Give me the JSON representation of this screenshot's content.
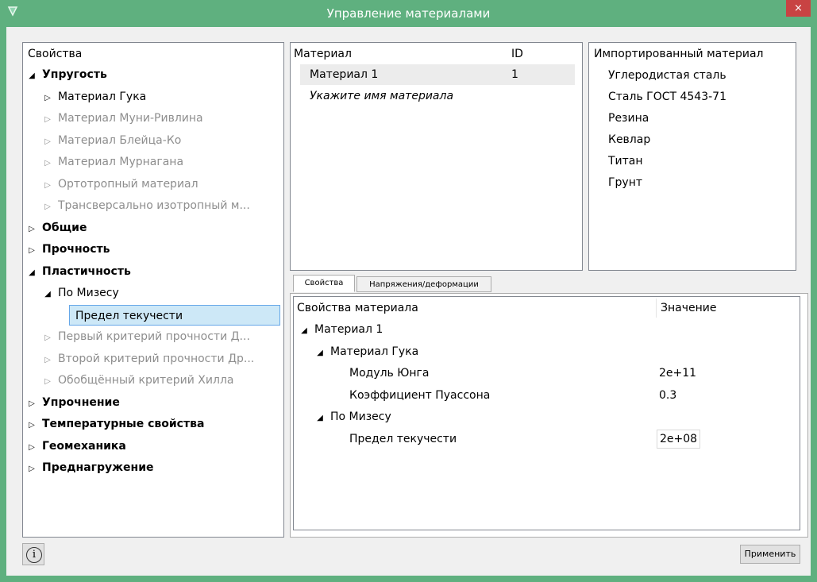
{
  "window": {
    "title": "Управление материалами",
    "close_glyph": "×"
  },
  "left_panel": {
    "header": "Свойства",
    "items": [
      {
        "label": "Упругость",
        "level": 0,
        "arrow": "◢",
        "style": "bold"
      },
      {
        "label": "Материал Гука",
        "level": 1,
        "arrow": "▷",
        "style": "normal"
      },
      {
        "label": "Материал Муни-Ривлина",
        "level": 1,
        "arrow": "▷",
        "style": "gray"
      },
      {
        "label": "Материал Блейца-Ко",
        "level": 1,
        "arrow": "▷",
        "style": "gray"
      },
      {
        "label": "Материал Мурнагана",
        "level": 1,
        "arrow": "▷",
        "style": "gray"
      },
      {
        "label": "Ортотропный материал",
        "level": 1,
        "arrow": "▷",
        "style": "gray"
      },
      {
        "label": "Трансверсально изотропный м...",
        "level": 1,
        "arrow": "▷",
        "style": "gray"
      },
      {
        "label": "Общие",
        "level": 0,
        "arrow": "▷",
        "style": "bold"
      },
      {
        "label": "Прочность",
        "level": 0,
        "arrow": "▷",
        "style": "bold"
      },
      {
        "label": "Пластичность",
        "level": 0,
        "arrow": "◢",
        "style": "bold"
      },
      {
        "label": "По Мизесу",
        "level": 1,
        "arrow": "◢",
        "style": "normal"
      },
      {
        "label": "Предел текучести",
        "level": 2,
        "arrow": "",
        "style": "selected"
      },
      {
        "label": "Первый критерий прочности Д...",
        "level": 1,
        "arrow": "▷",
        "style": "gray"
      },
      {
        "label": "Второй критерий прочности Др...",
        "level": 1,
        "arrow": "▷",
        "style": "gray"
      },
      {
        "label": "Обобщённый критерий Хилла",
        "level": 1,
        "arrow": "▷",
        "style": "gray"
      },
      {
        "label": "Упрочнение",
        "level": 0,
        "arrow": "▷",
        "style": "bold"
      },
      {
        "label": "Температурные свойства",
        "level": 0,
        "arrow": "▷",
        "style": "bold"
      },
      {
        "label": "Геомеханика",
        "level": 0,
        "arrow": "▷",
        "style": "bold"
      },
      {
        "label": "Преднагружение",
        "level": 0,
        "arrow": "▷",
        "style": "bold"
      }
    ]
  },
  "materials_panel": {
    "col_material": "Материал",
    "col_id": "ID",
    "rows": [
      {
        "name": "Материал 1",
        "id": "1"
      }
    ],
    "placeholder": "Укажите имя материала"
  },
  "imported_panel": {
    "header": "Импортированный материал",
    "items": [
      "Углеродистая сталь",
      "Сталь ГОСТ 4543-71",
      "Резина",
      "Кевлар",
      "Титан",
      "Грунт"
    ]
  },
  "tabs": [
    {
      "label": "Свойства",
      "active": true
    },
    {
      "label": "Напряжения/деформации",
      "active": false
    }
  ],
  "props_panel": {
    "col_property": "Свойства материала",
    "col_value": "Значение",
    "rows": [
      {
        "label": "Материал 1",
        "value": "",
        "level": 0,
        "arrow": "◢"
      },
      {
        "label": "Материал Гука",
        "value": "",
        "level": 1,
        "arrow": "◢"
      },
      {
        "label": "Модуль Юнга",
        "value": "2e+11",
        "level": 2,
        "arrow": ""
      },
      {
        "label": "Коэффициент Пуассона",
        "value": "0.3",
        "level": 2,
        "arrow": ""
      },
      {
        "label": "По Мизесу",
        "value": "",
        "level": 1,
        "arrow": "◢"
      },
      {
        "label": "Предел текучести",
        "value": "2e+08",
        "level": 2,
        "arrow": "",
        "editing": true
      }
    ]
  },
  "footer": {
    "apply_label": "Применить",
    "info_glyph": "i"
  },
  "colors": {
    "titlebar": "#5fb07f",
    "close": "#c84343",
    "selection": "#cde8f7",
    "selection_border": "#66a7e8"
  }
}
